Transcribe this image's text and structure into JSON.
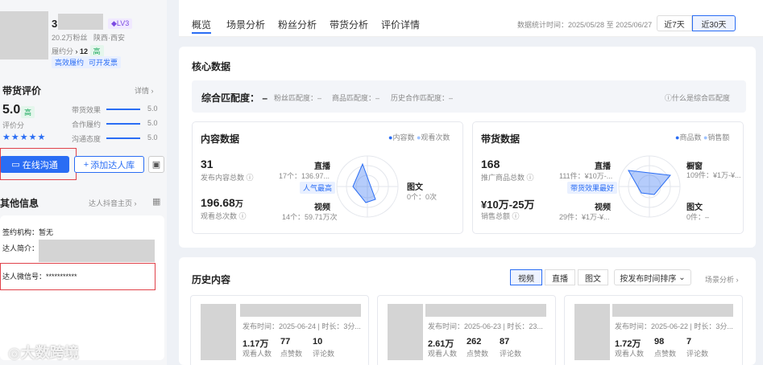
{
  "profile": {
    "name_prefix": "3",
    "level": "LV3",
    "followers": "20.2万粉丝",
    "location": "陕西·西安",
    "fulfillment_label": "履约分",
    "fulfillment_score": "12",
    "fulfillment_grade": "高",
    "tag1": "高效履约",
    "tag2": "可开发票"
  },
  "review": {
    "title": "带货评价",
    "detail": "详情",
    "score": "5.0",
    "score_grade": "高",
    "score_label": "评价分",
    "metrics": [
      {
        "label": "带货效果",
        "value": "5.0"
      },
      {
        "label": "合作履约",
        "value": "5.0"
      },
      {
        "label": "沟通态度",
        "value": "5.0"
      }
    ],
    "stars": "★★★★★"
  },
  "actions": {
    "chat": "在线沟通",
    "add": "添加达人库"
  },
  "other": {
    "title": "其他信息",
    "link": "达人抖音主页",
    "org_label": "签约机构：",
    "org_value": "暂无",
    "intro_label": "达人简介：",
    "wechat_label": "达人微信号：",
    "wechat_value": "***********",
    "watermark": "大数跨境"
  },
  "tabs": [
    "概览",
    "场景分析",
    "粉丝分析",
    "带货分析",
    "评价详情"
  ],
  "stats_range": {
    "label": "数据统计时间：",
    "start": "2025/05/28",
    "sep": "至",
    "end": "2025/06/27",
    "b7": "近7天",
    "b30": "近30天"
  },
  "core": {
    "title": "核心数据",
    "match_label": "综合匹配度：",
    "match_value": "–",
    "sub": [
      {
        "label": "粉丝匹配度：",
        "value": "–"
      },
      {
        "label": "商品匹配度：",
        "value": "–"
      },
      {
        "label": "历史合作匹配度：",
        "value": "–"
      }
    ],
    "help": "什么是综合匹配度"
  },
  "content": {
    "title": "内容数据",
    "legend": [
      "内容数",
      "观看次数"
    ],
    "v1": "31",
    "l1": "发布内容总数",
    "v2": "196.68",
    "v2u": "万",
    "l2": "观看总次数",
    "live": "直播",
    "live_val": "17个：136.97...",
    "badge": "人气最高",
    "video": "视频",
    "video_val": "14个：59.71万次",
    "tw": "图文",
    "tw_val": "0个：0次"
  },
  "goods": {
    "title": "带货数据",
    "legend": [
      "商品数",
      "销售额"
    ],
    "v1": "168",
    "l1": "推广商品总数",
    "v2": "¥10万-25万",
    "l2": "销售总额",
    "live": "直播",
    "live_val": "111件：¥10万-...",
    "badge": "带货效果最好",
    "video": "视频",
    "video_val": "29件：¥1万-¥...",
    "win": "橱窗",
    "win_val": "109件：¥1万-¥...",
    "tw": "图文",
    "tw_val": "0件：–"
  },
  "history": {
    "title": "历史内容",
    "filters": [
      "视频",
      "直播",
      "图文"
    ],
    "sort": "按发布时间排序",
    "scene": "场景分析",
    "cards": [
      {
        "date": "发布时间：2025-06-24",
        "dur": "时长：3分...",
        "views": "1.17万",
        "likes": "77",
        "comments": "10"
      },
      {
        "date": "发布时间：2025-06-23",
        "dur": "时长：23...",
        "views": "2.61万",
        "likes": "262",
        "comments": "87"
      },
      {
        "date": "发布时间：2025-06-22",
        "dur": "时长：3分...",
        "views": "1.72万",
        "likes": "98",
        "comments": "7"
      }
    ],
    "views_label": "观看人数",
    "likes_label": "点赞数",
    "comments_label": "评论数"
  },
  "colors": {
    "accent": "#2a6df4",
    "red": "#e0424a",
    "green": "#1aa85c"
  }
}
